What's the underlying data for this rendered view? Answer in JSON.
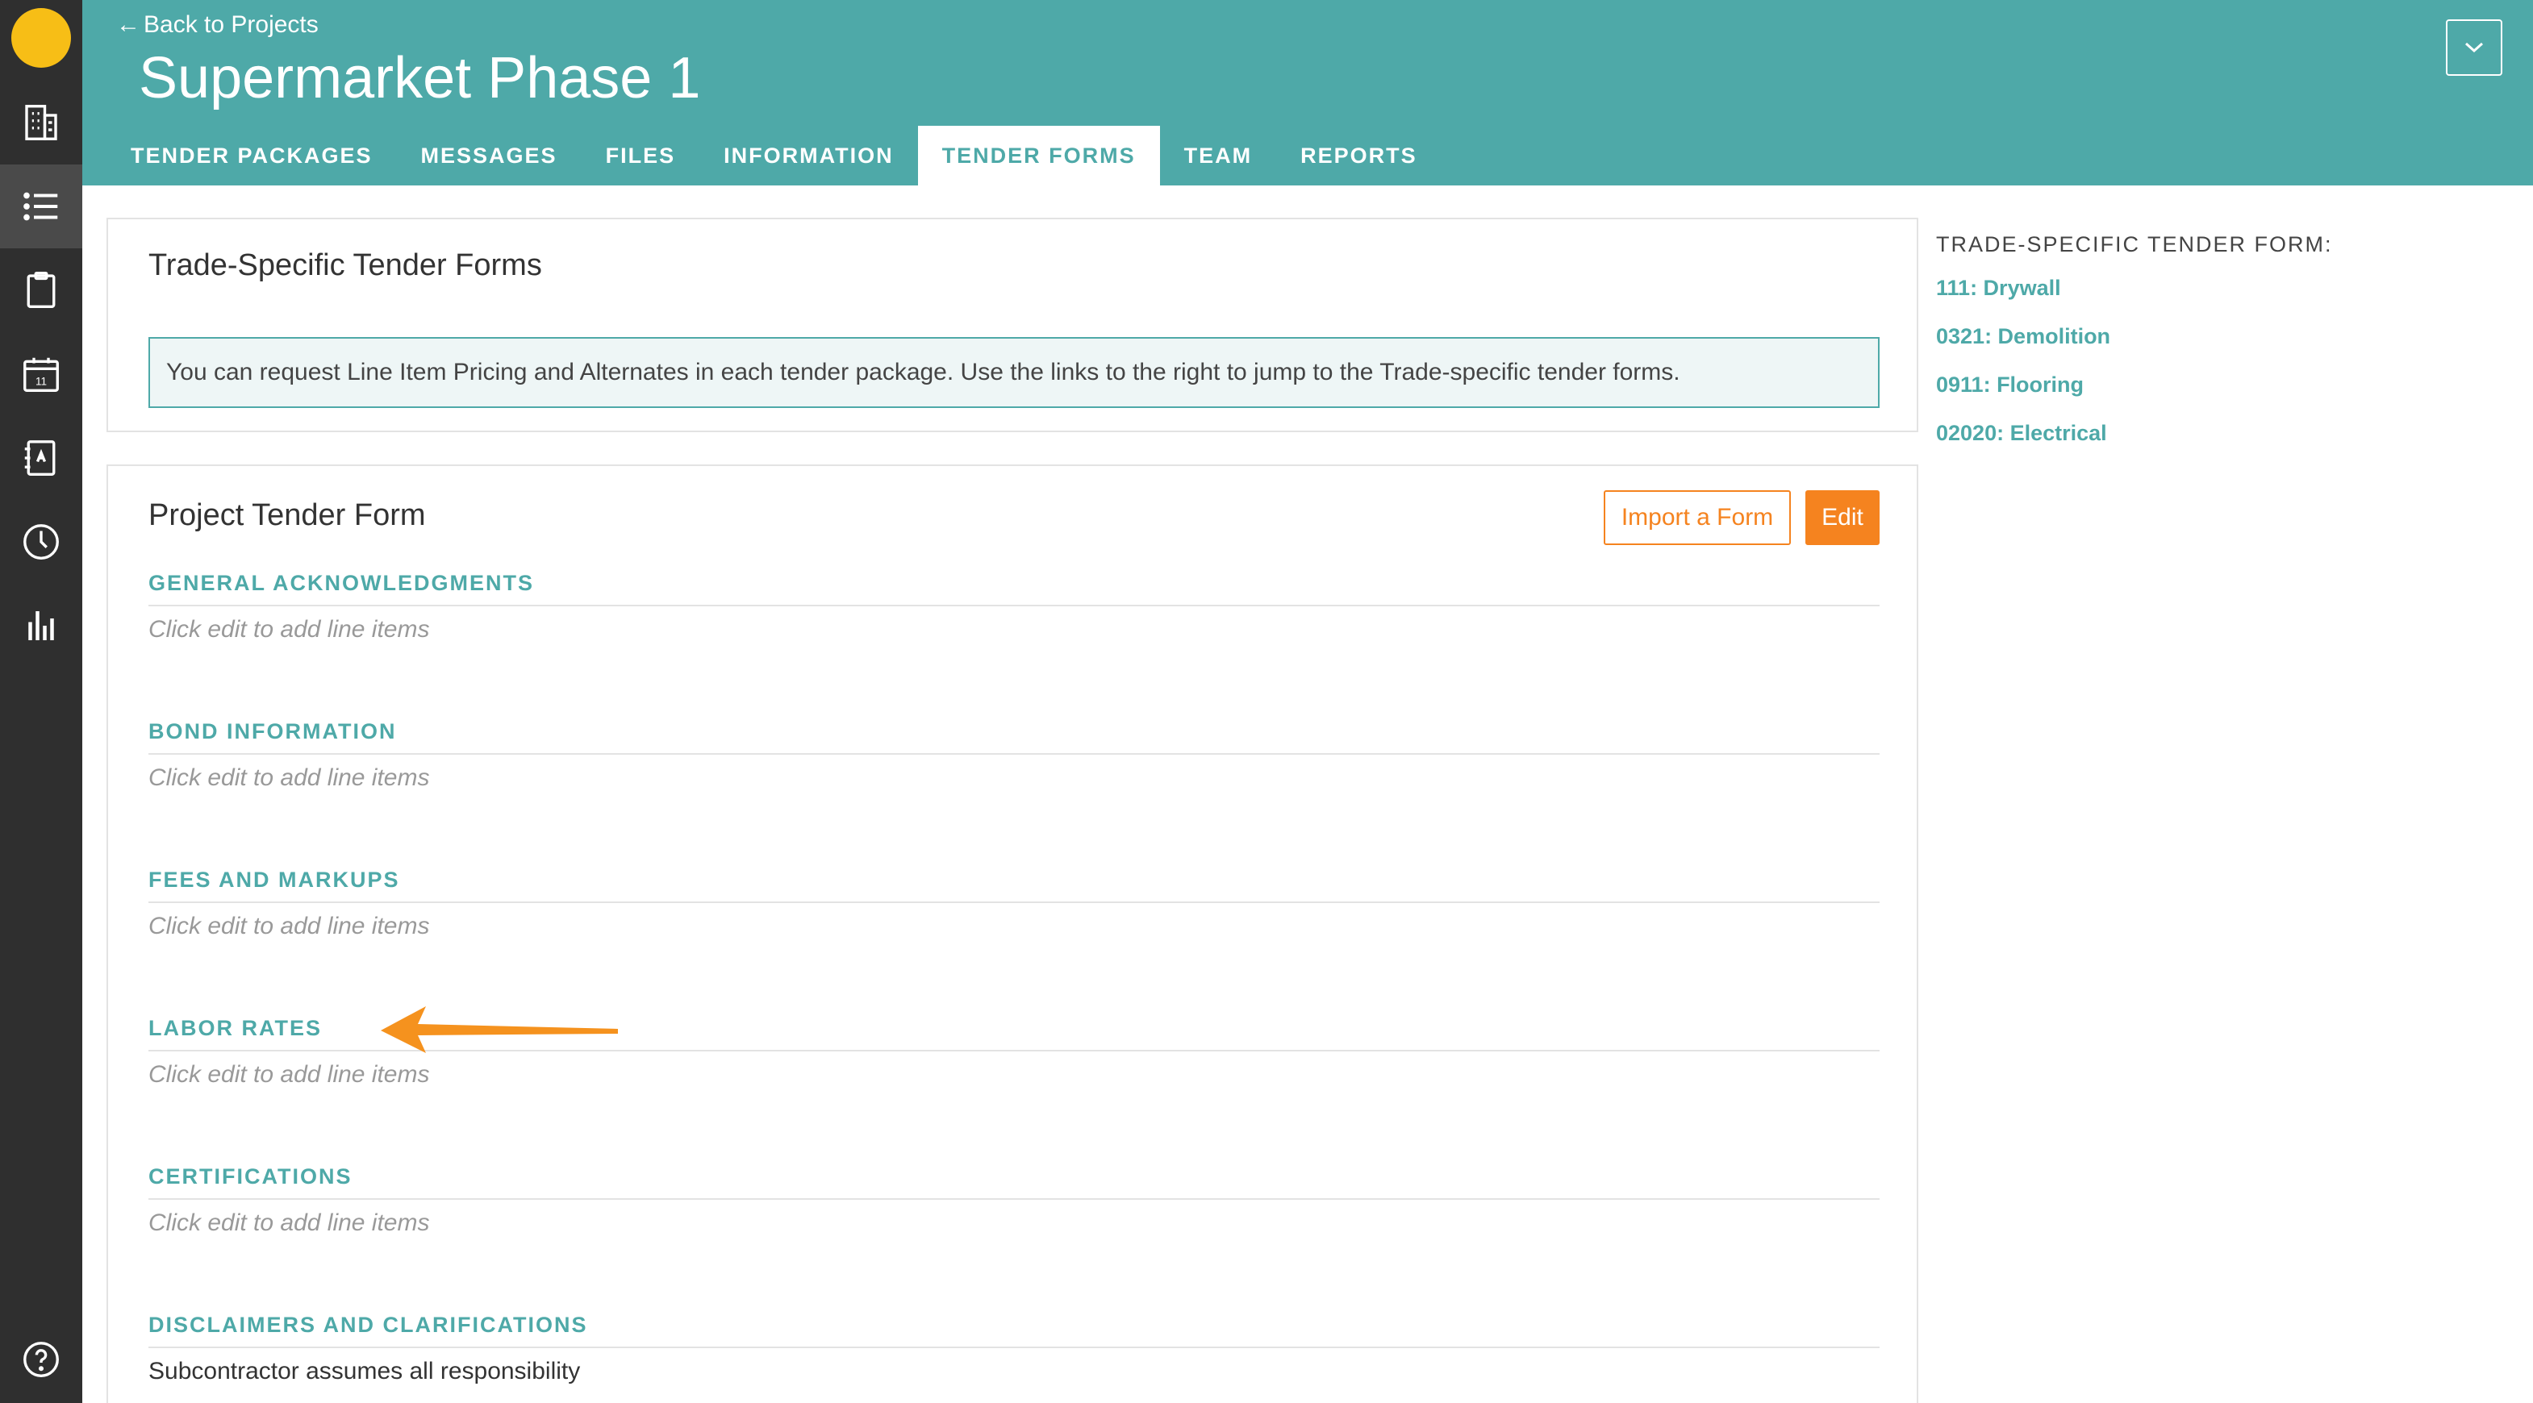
{
  "nav": {
    "back_label": "Back to Projects",
    "project_title": "Supermarket Phase 1",
    "tabs": [
      {
        "label": "TENDER PACKAGES"
      },
      {
        "label": "MESSAGES"
      },
      {
        "label": "FILES"
      },
      {
        "label": "INFORMATION"
      },
      {
        "label": "TENDER FORMS"
      },
      {
        "label": "TEAM"
      },
      {
        "label": "REPORTS"
      }
    ],
    "active_tab": "TENDER FORMS"
  },
  "rail": {
    "icons": [
      "logo",
      "building-icon",
      "list-icon",
      "clipboard-icon",
      "calendar-icon",
      "address-book-icon",
      "clock-icon",
      "bar-chart-icon",
      "help-icon"
    ],
    "active": "list-icon",
    "calendar_day": "11"
  },
  "trade_forms_card": {
    "title": "Trade-Specific Tender Forms",
    "notice": "You can request Line Item Pricing and Alternates in each tender package. Use the links to the right to jump to the Trade-specific tender forms."
  },
  "project_form": {
    "title": "Project Tender Form",
    "import_label": "Import a Form",
    "edit_label": "Edit",
    "sections": [
      {
        "heading": "GENERAL ACKNOWLEDGMENTS",
        "body": "Click edit to add line items"
      },
      {
        "heading": "BOND INFORMATION",
        "body": "Click edit to add line items"
      },
      {
        "heading": "FEES AND MARKUPS",
        "body": "Click edit to add line items"
      },
      {
        "heading": "LABOR RATES",
        "body": "Click edit to add line items"
      },
      {
        "heading": "CERTIFICATIONS",
        "body": "Click edit to add line items"
      },
      {
        "heading": "DISCLAIMERS AND CLARIFICATIONS",
        "body": "Subcontractor assumes all responsibility"
      }
    ]
  },
  "sidebar": {
    "heading": "TRADE-SPECIFIC TENDER FORM:",
    "links": [
      "111: Drywall",
      "0321: Demolition",
      "0911: Flooring",
      "02020: Electrical"
    ]
  },
  "colors": {
    "brand": "#4ea9a8",
    "accent": "#f5831f",
    "rail": "#2f2f2f",
    "logo": "#f7be16"
  }
}
